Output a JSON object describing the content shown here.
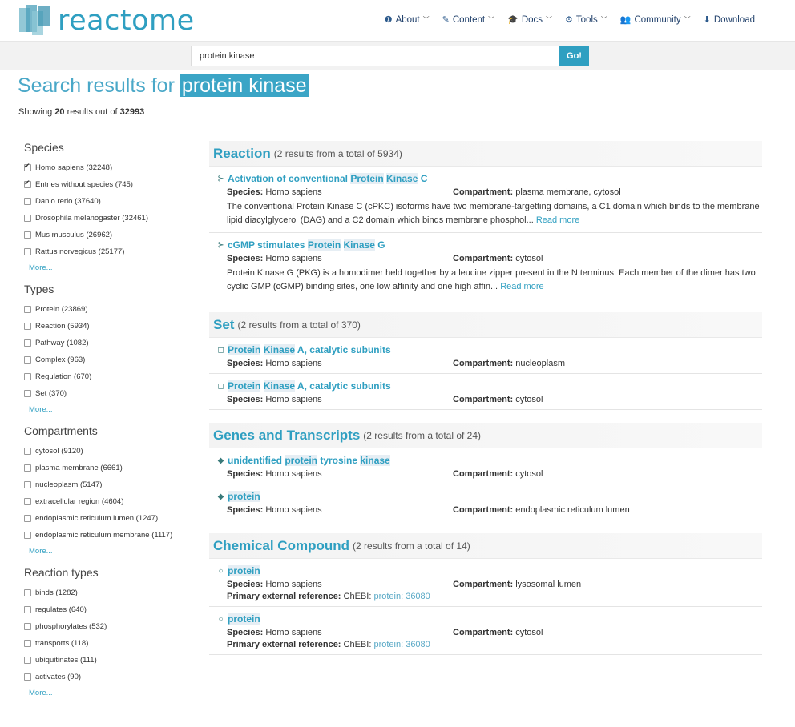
{
  "header": {
    "logo_text": "reactome",
    "nav": [
      {
        "icon": "info-icon",
        "glyph": "❶",
        "label": "About",
        "caret": "﹀"
      },
      {
        "icon": "edit-icon",
        "glyph": "✎",
        "label": "Content",
        "caret": "﹀"
      },
      {
        "icon": "graduation-cap-icon",
        "glyph": "🎓",
        "label": "Docs",
        "caret": "﹀"
      },
      {
        "icon": "cogs-icon",
        "glyph": "⚙",
        "label": "Tools",
        "caret": "﹀"
      },
      {
        "icon": "users-icon",
        "glyph": "👥",
        "label": "Community",
        "caret": "﹀"
      },
      {
        "icon": "download-icon",
        "glyph": "⬇",
        "label": "Download",
        "caret": ""
      }
    ]
  },
  "search": {
    "value": "protein kinase",
    "button": "Go!"
  },
  "title": {
    "prefix": "Search results for",
    "query": "protein kinase"
  },
  "showing": {
    "pre": "Showing",
    "shown": "20",
    "mid": "results out of",
    "total": "32993"
  },
  "sidebar": {
    "facets": [
      {
        "title": "Species",
        "items": [
          {
            "label": "Homo sapiens (32248)",
            "checked": true
          },
          {
            "label": "Entries without species (745)",
            "checked": true
          },
          {
            "label": "Danio rerio (37640)",
            "checked": false
          },
          {
            "label": "Drosophila melanogaster (32461)",
            "checked": false
          },
          {
            "label": "Mus musculus (26962)",
            "checked": false
          },
          {
            "label": "Rattus norvegicus (25177)",
            "checked": false
          }
        ],
        "more": "More..."
      },
      {
        "title": "Types",
        "items": [
          {
            "label": "Protein (23869)",
            "checked": false
          },
          {
            "label": "Reaction (5934)",
            "checked": false
          },
          {
            "label": "Pathway (1082)",
            "checked": false
          },
          {
            "label": "Complex (963)",
            "checked": false
          },
          {
            "label": "Regulation (670)",
            "checked": false
          },
          {
            "label": "Set (370)",
            "checked": false
          }
        ],
        "more": "More..."
      },
      {
        "title": "Compartments",
        "items": [
          {
            "label": "cytosol (9120)",
            "checked": false
          },
          {
            "label": "plasma membrane (6661)",
            "checked": false
          },
          {
            "label": "nucleoplasm (5147)",
            "checked": false
          },
          {
            "label": "extracellular region (4604)",
            "checked": false
          },
          {
            "label": "endoplasmic reticulum lumen (1247)",
            "checked": false
          },
          {
            "label": "endoplasmic reticulum membrane (1117)",
            "checked": false
          }
        ],
        "more": "More..."
      },
      {
        "title": "Reaction types",
        "items": [
          {
            "label": "binds (1282)",
            "checked": false
          },
          {
            "label": "regulates (640)",
            "checked": false
          },
          {
            "label": "phosphorylates (532)",
            "checked": false
          },
          {
            "label": "transports (118)",
            "checked": false
          },
          {
            "label": "ubiquitinates (111)",
            "checked": false
          },
          {
            "label": "activates (90)",
            "checked": false
          }
        ],
        "more": "More..."
      }
    ]
  },
  "results": [
    {
      "name": "Reaction",
      "count": "(2 results from a total of 5934)",
      "icon": "reaction-icon",
      "glyph": "⊱",
      "items": [
        {
          "title_parts": [
            {
              "t": "Activation of conventional "
            },
            {
              "t": "Protein",
              "hl": true
            },
            {
              "t": " "
            },
            {
              "t": "Kinase",
              "hl": true
            },
            {
              "t": " C"
            }
          ],
          "species_label": "Species:",
          "species": "Homo sapiens",
          "compartment_label": "Compartment:",
          "compartment": "plasma membrane, cytosol",
          "desc": "The conventional Protein Kinase C (cPKC) isoforms have two membrane-targetting domains, a C1 domain which binds to the membrane lipid diacylglycerol (DAG) and a C2 domain which binds membrane phosphol...",
          "read_more": "Read more"
        },
        {
          "title_parts": [
            {
              "t": "cGMP stimulates "
            },
            {
              "t": "Protein",
              "hl": true
            },
            {
              "t": " "
            },
            {
              "t": "Kinase",
              "hl": true
            },
            {
              "t": " G"
            }
          ],
          "species_label": "Species:",
          "species": "Homo sapiens",
          "compartment_label": "Compartment:",
          "compartment": "cytosol",
          "desc": "Protein Kinase G (PKG) is a homodimer held together by a leucine zipper present in the N terminus. Each member of the dimer has two cyclic GMP (cGMP) binding sites, one low affinity and one high affin...",
          "read_more": "Read more"
        }
      ]
    },
    {
      "name": "Set",
      "count": "(2 results from a total of 370)",
      "icon": "set-icon",
      "glyph": "◻",
      "items": [
        {
          "title_parts": [
            {
              "t": "Protein",
              "hl": true
            },
            {
              "t": " "
            },
            {
              "t": "Kinase",
              "hl": true
            },
            {
              "t": " A, catalytic subunits"
            }
          ],
          "species_label": "Species:",
          "species": "Homo sapiens",
          "compartment_label": "Compartment:",
          "compartment": "nucleoplasm"
        },
        {
          "title_parts": [
            {
              "t": "Protein",
              "hl": true
            },
            {
              "t": " "
            },
            {
              "t": "Kinase",
              "hl": true
            },
            {
              "t": " A, catalytic subunits"
            }
          ],
          "species_label": "Species:",
          "species": "Homo sapiens",
          "compartment_label": "Compartment:",
          "compartment": "cytosol"
        }
      ]
    },
    {
      "name": "Genes and Transcripts",
      "count": "(2 results from a total of 24)",
      "icon": "gene-icon",
      "glyph": "◆",
      "items": [
        {
          "title_parts": [
            {
              "t": "unidentified "
            },
            {
              "t": "protein",
              "hl": true
            },
            {
              "t": " tyrosine "
            },
            {
              "t": "kinase",
              "hl": true
            }
          ],
          "species_label": "Species:",
          "species": "Homo sapiens",
          "compartment_label": "Compartment:",
          "compartment": "cytosol"
        },
        {
          "title_parts": [
            {
              "t": "protein",
              "hl": true
            }
          ],
          "species_label": "Species:",
          "species": "Homo sapiens",
          "compartment_label": "Compartment:",
          "compartment": "endoplasmic reticulum lumen"
        }
      ]
    },
    {
      "name": "Chemical Compound",
      "count": "(2 results from a total of 14)",
      "icon": "chemical-icon",
      "glyph": "○",
      "items": [
        {
          "title_parts": [
            {
              "t": "protein",
              "hl": true
            }
          ],
          "species_label": "Species:",
          "species": "Homo sapiens",
          "compartment_label": "Compartment:",
          "compartment": "lysosomal lumen",
          "ref_label": "Primary external reference:",
          "ref_db": "ChEBI:",
          "ref_link": "protein: 36080"
        },
        {
          "title_parts": [
            {
              "t": "protein",
              "hl": true
            }
          ],
          "species_label": "Species:",
          "species": "Homo sapiens",
          "compartment_label": "Compartment:",
          "compartment": "cytosol",
          "ref_label": "Primary external reference:",
          "ref_db": "ChEBI:",
          "ref_link": "protein: 36080"
        }
      ]
    }
  ]
}
